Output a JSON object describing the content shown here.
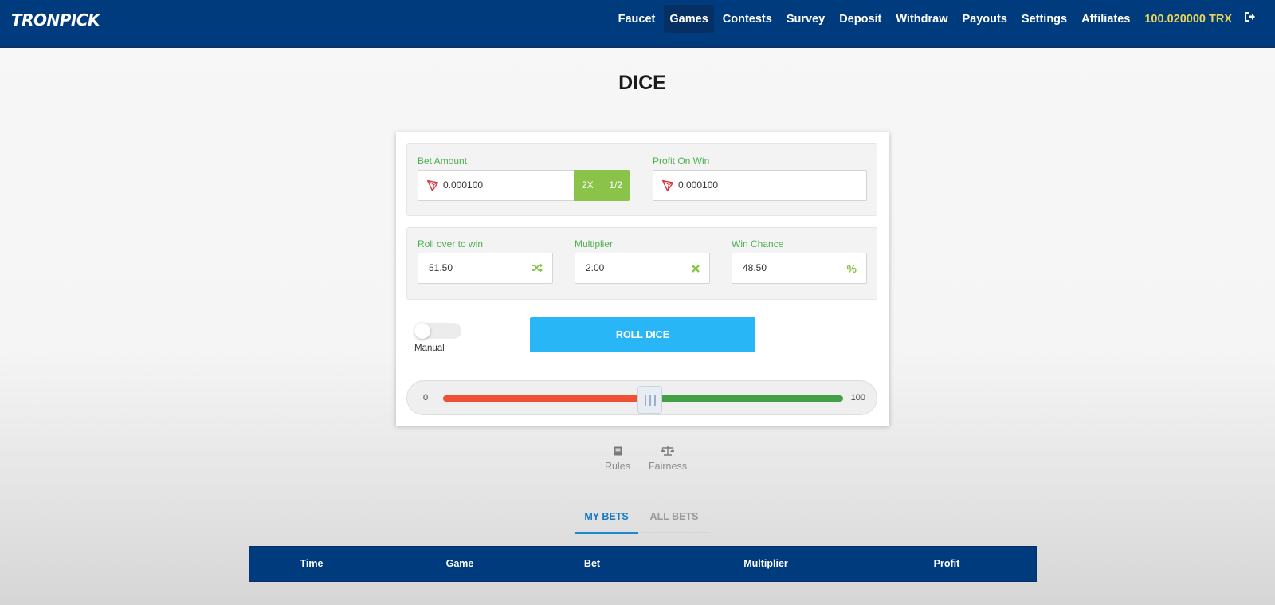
{
  "navbar": {
    "logo": "TRONPICK",
    "items": [
      {
        "label": "Faucet",
        "active": false
      },
      {
        "label": "Games",
        "active": true
      },
      {
        "label": "Contests",
        "active": false
      },
      {
        "label": "Survey",
        "active": false
      },
      {
        "label": "Deposit",
        "active": false
      },
      {
        "label": "Withdraw",
        "active": false
      },
      {
        "label": "Payouts",
        "active": false
      },
      {
        "label": "Settings",
        "active": false
      },
      {
        "label": "Affiliates",
        "active": false
      }
    ],
    "balance": "100.020000 TRX",
    "logout_icon": "sign-out-icon"
  },
  "page": {
    "title": "DICE"
  },
  "bet": {
    "amount_label": "Bet Amount",
    "amount_value": "0.000100",
    "double_label": "2X",
    "half_label": "1/2",
    "profit_label": "Profit On Win",
    "profit_value": "0.000100"
  },
  "roll": {
    "rollover_label": "Roll over to win",
    "rollover_value": "51.50",
    "rollover_icon": "shuffle-icon",
    "multiplier_label": "Multiplier",
    "multiplier_value": "2.00",
    "multiplier_icon": "times-icon",
    "chance_label": "Win Chance",
    "chance_value": "48.50",
    "chance_icon": "percent-icon"
  },
  "controls": {
    "mode_label": "Manual",
    "auto_enabled": false,
    "roll_button": "ROLL DICE"
  },
  "slider": {
    "min": "0",
    "max": "100",
    "value": 51.5
  },
  "links": {
    "rules": "Rules",
    "fairness": "Fairness"
  },
  "tabs": {
    "my_bets": "MY BETS",
    "all_bets": "ALL BETS"
  },
  "table": {
    "columns": [
      "Time",
      "Game",
      "Bet",
      "Multiplier",
      "Profit"
    ]
  },
  "colors": {
    "navbar": "#003b7e",
    "accent_green": "#8bc34a",
    "roll_button": "#29b6f6",
    "balance": "#e8d65a",
    "slider_lose": "#f05033",
    "slider_win": "#43a047"
  }
}
